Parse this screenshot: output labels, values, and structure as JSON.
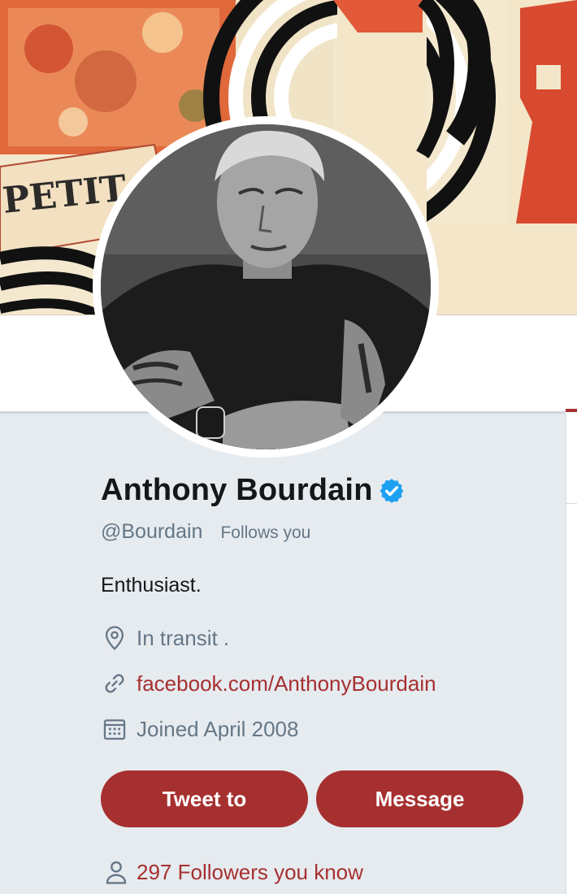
{
  "banner": {
    "sign_text_main": "PETIT",
    "icon": "banner-artwork"
  },
  "profile": {
    "name": "Anthony Bourdain",
    "verified_icon": "verified-badge-icon",
    "handle": "@Bourdain",
    "follows_you": "Follows you",
    "bio": "Enthusiast.",
    "location": "In transit .",
    "website": "facebook.com/AnthonyBourdain",
    "joined": "Joined April 2008"
  },
  "actions": {
    "tweet_to": "Tweet to",
    "message": "Message"
  },
  "followers_you_know": "297 Followers you know",
  "colors": {
    "accent": "#a6302f",
    "secondary_text": "#657786",
    "card_bg": "#e6ebf0",
    "verified": "#1da1f2"
  }
}
